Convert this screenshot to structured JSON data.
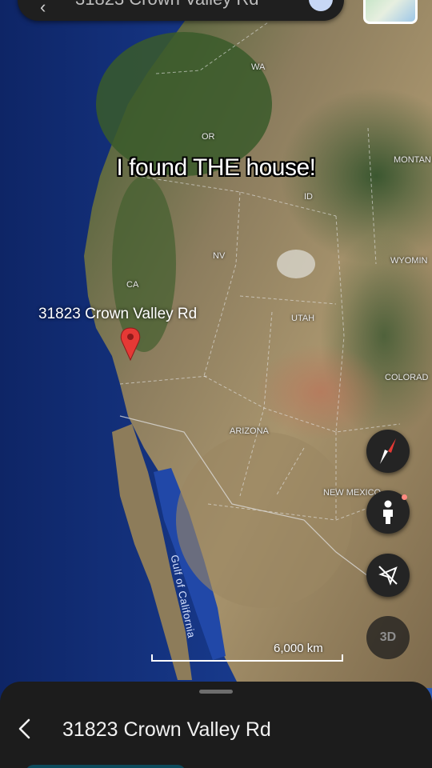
{
  "search": {
    "query": "31823 Crown Valley Rd",
    "back_icon": "arrow-back-icon",
    "avatar_icon": "account-avatar-icon"
  },
  "layers": {
    "icon": "map-layers-thumbnail"
  },
  "overlay": {
    "caption": "I found THE house!"
  },
  "map": {
    "style": "satellite",
    "region_labels": {
      "wa": "WA",
      "or": "OR",
      "id": "ID",
      "montana": "MONTAN",
      "wyoming": "WYOMIN",
      "nv": "NV",
      "ca": "CA",
      "utah": "UTAH",
      "colorado": "COLORAD",
      "arizona": "ARIZONA",
      "new_mexico": "NEW MEXICO"
    },
    "water_labels": {
      "gulf": "Gulf of California"
    },
    "pin": {
      "label": "31823 Crown Valley Rd",
      "color": "#e53935"
    },
    "scale": {
      "label": "6,000 km"
    }
  },
  "controls": {
    "compass": "compass-icon",
    "pegman": "pegman-icon",
    "location": "location-off-icon",
    "three_d": "3D"
  },
  "sheet": {
    "back_icon": "chevron-left-icon",
    "title": "31823 Crown Valley Rd"
  },
  "colors": {
    "ocean": "#12307a",
    "land_green": "#3f5a2e",
    "land_desert": "#a08d6c",
    "panel": "#1c1c1c"
  }
}
